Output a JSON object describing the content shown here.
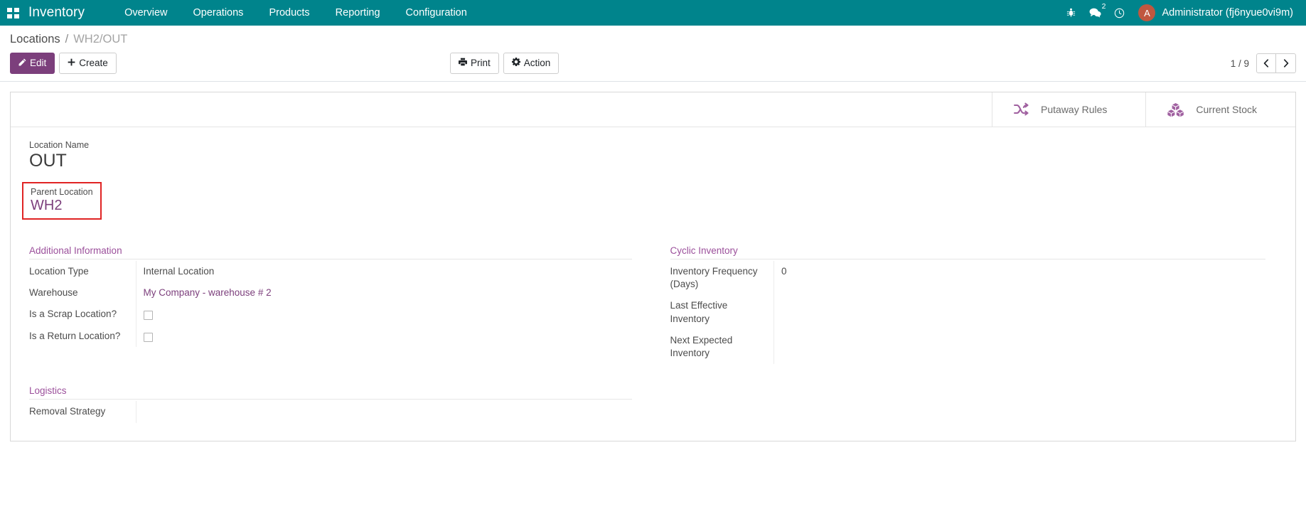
{
  "navbar": {
    "apps_icon": "apps-grid-icon",
    "brand": "Inventory",
    "menu": [
      {
        "label": "Overview"
      },
      {
        "label": "Operations"
      },
      {
        "label": "Products"
      },
      {
        "label": "Reporting"
      },
      {
        "label": "Configuration"
      }
    ],
    "icons": {
      "debug": "bug-icon",
      "messages": "chat-bubble-icon",
      "messages_count": "2",
      "activities": "clock-icon"
    },
    "user": {
      "avatar_initial": "A",
      "name": "Administrator (fj6nyue0vi9m)",
      "avatar_color": "#c0573f"
    }
  },
  "control_panel": {
    "breadcrumb": {
      "root": "Locations",
      "separator": "/",
      "current": "WH2/OUT"
    },
    "buttons": {
      "edit": "Edit",
      "create": "Create",
      "print": "Print",
      "action": "Action"
    },
    "pager": {
      "value": "1 / 9",
      "prev_icon": "chevron-left-icon",
      "next_icon": "chevron-right-icon"
    }
  },
  "stat_buttons": [
    {
      "label": "Putaway Rules",
      "icon": "shuffle-icon"
    },
    {
      "label": "Current Stock",
      "icon": "cubes-icon"
    }
  ],
  "form": {
    "location_name": {
      "label": "Location Name",
      "value": "OUT"
    },
    "parent_location": {
      "label": "Parent Location",
      "value": "WH2",
      "highlight_color": "#e02424"
    },
    "additional_information": {
      "title": "Additional Information",
      "fields": [
        {
          "label": "Location Type",
          "value": "Internal Location",
          "type": "text"
        },
        {
          "label": "Warehouse",
          "value": "My Company - warehouse # 2",
          "type": "link"
        },
        {
          "label": "Is a Scrap Location?",
          "value": "",
          "type": "checkbox",
          "checked": false
        },
        {
          "label": "Is a Return Location?",
          "value": "",
          "type": "checkbox",
          "checked": false
        }
      ]
    },
    "cyclic_inventory": {
      "title": "Cyclic Inventory",
      "fields": [
        {
          "label": "Inventory Frequency (Days)",
          "value": "0",
          "type": "text"
        },
        {
          "label": "Last Effective Inventory",
          "value": "",
          "type": "text"
        },
        {
          "label": "Next Expected Inventory",
          "value": "",
          "type": "text"
        }
      ]
    },
    "logistics": {
      "title": "Logistics",
      "fields": [
        {
          "label": "Removal Strategy",
          "value": "",
          "type": "text"
        }
      ]
    }
  },
  "colors": {
    "navbar": "#00848c",
    "primary": "#7c3f7c",
    "section_heading": "#9b4f9b"
  }
}
